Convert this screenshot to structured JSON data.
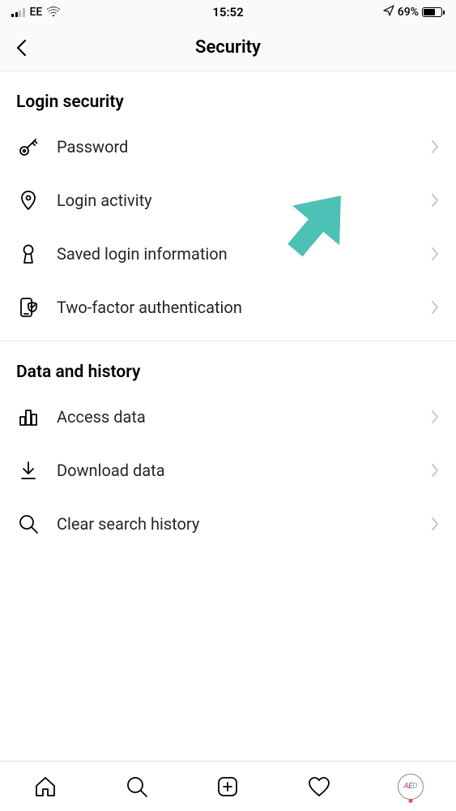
{
  "status": {
    "carrier": "EE",
    "time": "15:52",
    "battery_pct": "69%",
    "battery_fill": 69
  },
  "nav": {
    "title": "Security"
  },
  "sections": [
    {
      "header": "Login security",
      "items": [
        {
          "label": "Password",
          "icon": "key-icon"
        },
        {
          "label": "Login activity",
          "icon": "location-pin-icon"
        },
        {
          "label": "Saved login information",
          "icon": "keyhole-icon"
        },
        {
          "label": "Two-factor authentication",
          "icon": "phone-shield-icon"
        }
      ]
    },
    {
      "header": "Data and history",
      "items": [
        {
          "label": "Access data",
          "icon": "bar-chart-icon"
        },
        {
          "label": "Download data",
          "icon": "download-icon"
        },
        {
          "label": "Clear search history",
          "icon": "magnifier-icon"
        }
      ]
    }
  ],
  "annotation": {
    "arrow_color": "#4cc1b5",
    "points_to": "Saved login information"
  },
  "tabs": [
    {
      "name": "home",
      "icon": "home-icon"
    },
    {
      "name": "search",
      "icon": "search-icon"
    },
    {
      "name": "create",
      "icon": "plus-box-icon"
    },
    {
      "name": "activity",
      "icon": "heart-icon"
    },
    {
      "name": "profile",
      "icon": "avatar-icon",
      "badge": true
    }
  ],
  "avatar_text": "AED"
}
